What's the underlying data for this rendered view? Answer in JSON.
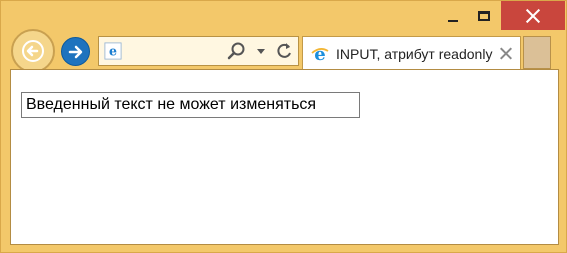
{
  "window": {
    "tab_title": "INPUT, атрибут readonly"
  },
  "page": {
    "readonly_input_value": "Введенный текст не может изменяться"
  },
  "icons": {
    "back": "back-arrow-icon",
    "forward": "forward-arrow-icon",
    "site": "ie-logo-icon",
    "search": "search-icon",
    "dropdown": "chevron-down-icon",
    "refresh": "refresh-icon",
    "close_tab": "close-icon",
    "minimize": "minimize-icon",
    "maximize": "maximize-icon",
    "close_window": "close-icon"
  },
  "colors": {
    "frame": "#f3c86a",
    "close_button": "#c9463d",
    "forward_button": "#1e73be"
  }
}
